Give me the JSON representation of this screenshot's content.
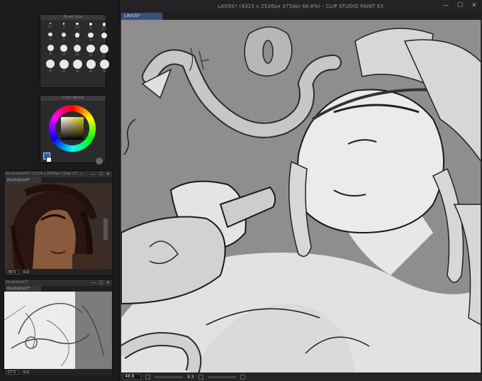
{
  "main": {
    "title": "LAVOS* (4315 x 2526px 375dpi 48.8%)  - CLIP STUDIO PAINT EX",
    "tab": "LAVOS*",
    "zoom": "48.8",
    "status_value": "9.3",
    "controls": [
      "—",
      "☐",
      "✕"
    ]
  },
  "brush_panel": {
    "header": "Brush Size",
    "sizes": [
      "0.7",
      "1",
      "1.5",
      "2",
      "2.5",
      "3",
      "4",
      "5",
      "6",
      "7",
      "8",
      "10",
      "12",
      "15",
      "17",
      "20",
      "25",
      "30",
      "40",
      "50"
    ]
  },
  "color_panel": {
    "header": "Color Wheel",
    "hue_color": "#d9c81e",
    "main_color": "#2a5cc0",
    "sub_color": "#ffffff"
  },
  "sub1": {
    "title": "illustration67* (1314 x 2049px 72dpi 23...)",
    "tab": "illustration6*",
    "zoom": "39.5",
    "value": "0.0",
    "controls": [
      "—",
      "☐",
      "✕"
    ]
  },
  "sub2": {
    "title": "illustration7*",
    "tab": "illustration7*",
    "zoom": "27.5",
    "value": "0.0",
    "controls": [
      "—",
      "☐",
      "✕"
    ]
  }
}
